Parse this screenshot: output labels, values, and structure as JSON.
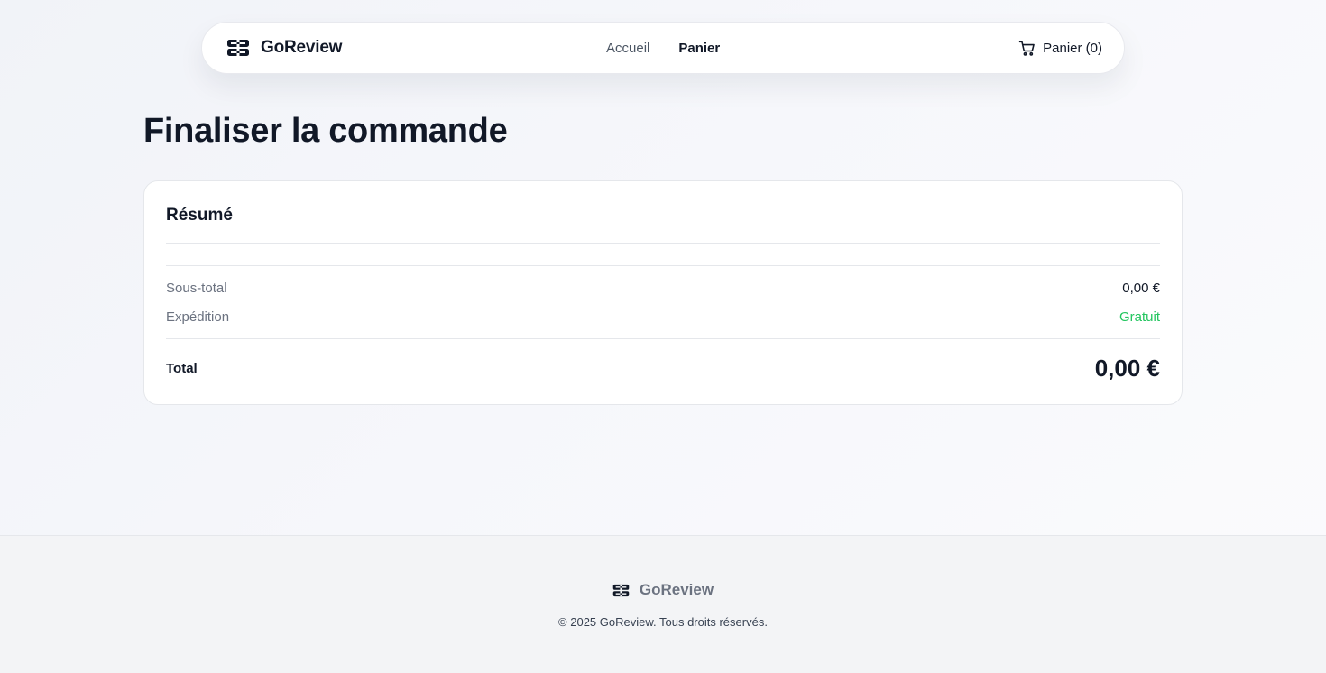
{
  "header": {
    "brand_name": "GoReview",
    "nav": [
      {
        "label": "Accueil",
        "active": false
      },
      {
        "label": "Panier",
        "active": true
      }
    ],
    "cart_label": "Panier (0)",
    "brand_icon": "gift-box-icon",
    "cart_icon": "shopping-cart-icon"
  },
  "main": {
    "title": "Finaliser la commande",
    "summary": {
      "heading": "Résumé",
      "subtotal_label": "Sous-total",
      "subtotal_value": "0,00 €",
      "shipping_label": "Expédition",
      "shipping_value": "Gratuit",
      "total_label": "Total",
      "total_value": "0,00 €"
    }
  },
  "footer": {
    "brand_name": "GoReview",
    "copyright": "© 2025 GoReview. Tous droits réservés."
  },
  "colors": {
    "text_primary": "#111827",
    "text_muted": "#6b7280",
    "success": "#22c55e",
    "border": "#e5e7eb"
  }
}
